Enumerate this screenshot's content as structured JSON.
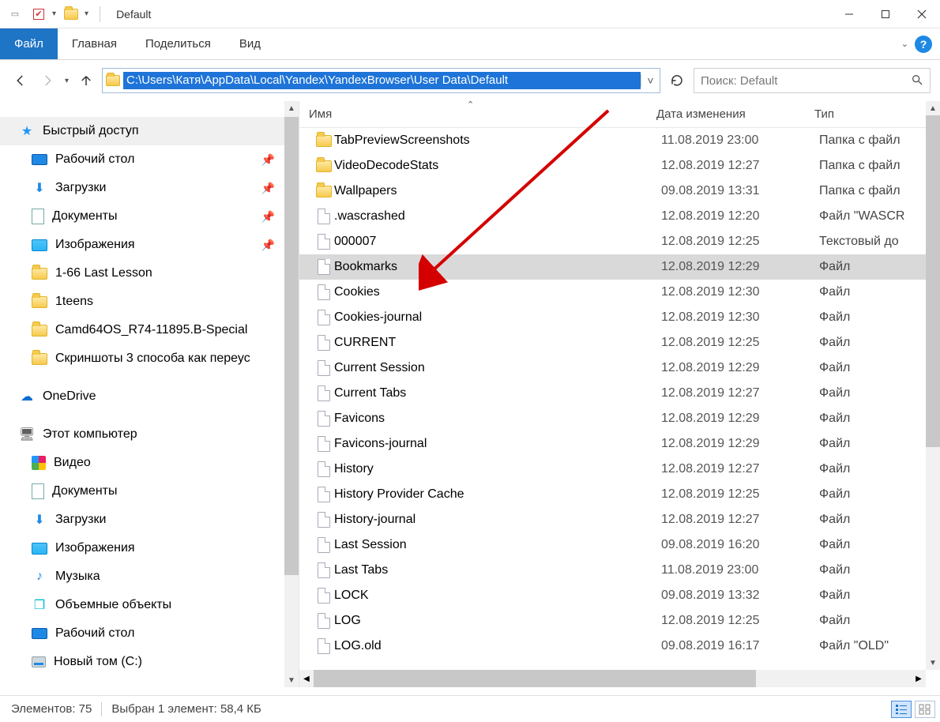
{
  "window": {
    "title": "Default"
  },
  "ribbon": {
    "file": "Файл",
    "tabs": [
      "Главная",
      "Поделиться",
      "Вид"
    ]
  },
  "address": {
    "path": "C:\\Users\\Катя\\AppData\\Local\\Yandex\\YandexBrowser\\User Data\\Default"
  },
  "search": {
    "placeholder": "Поиск: Default"
  },
  "sidebar": {
    "quick_access": "Быстрый доступ",
    "quick_items": [
      {
        "label": "Рабочий стол",
        "icon": "desktop",
        "pinned": true
      },
      {
        "label": "Загрузки",
        "icon": "download",
        "pinned": true
      },
      {
        "label": "Документы",
        "icon": "doc",
        "pinned": true
      },
      {
        "label": "Изображения",
        "icon": "image",
        "pinned": true
      },
      {
        "label": "1-66 Last Lesson",
        "icon": "folder",
        "pinned": false
      },
      {
        "label": "1teens",
        "icon": "folder",
        "pinned": false
      },
      {
        "label": "Camd64OS_R74-11895.B-Special",
        "icon": "folder",
        "pinned": false
      },
      {
        "label": "Скриншоты 3 способа как переус",
        "icon": "folder",
        "pinned": false
      }
    ],
    "onedrive": "OneDrive",
    "this_pc": "Этот компьютер",
    "pc_items": [
      {
        "label": "Видео",
        "icon": "video"
      },
      {
        "label": "Документы",
        "icon": "doc"
      },
      {
        "label": "Загрузки",
        "icon": "download"
      },
      {
        "label": "Изображения",
        "icon": "image"
      },
      {
        "label": "Музыка",
        "icon": "music"
      },
      {
        "label": "Объемные объекты",
        "icon": "obj3d"
      },
      {
        "label": "Рабочий стол",
        "icon": "desktop"
      },
      {
        "label": "Новый том (C:)",
        "icon": "disk"
      }
    ]
  },
  "columns": {
    "name": "Имя",
    "date": "Дата изменения",
    "type": "Тип"
  },
  "files": [
    {
      "name": "TabPreviewScreenshots",
      "date": "11.08.2019 23:00",
      "type": "Папка с файл",
      "icon": "folder"
    },
    {
      "name": "VideoDecodeStats",
      "date": "12.08.2019 12:27",
      "type": "Папка с файл",
      "icon": "folder"
    },
    {
      "name": "Wallpapers",
      "date": "09.08.2019 13:31",
      "type": "Папка с файл",
      "icon": "folder"
    },
    {
      "name": ".wascrashed",
      "date": "12.08.2019 12:20",
      "type": "Файл \"WASCR",
      "icon": "file"
    },
    {
      "name": "000007",
      "date": "12.08.2019 12:25",
      "type": "Текстовый до",
      "icon": "file"
    },
    {
      "name": "Bookmarks",
      "date": "12.08.2019 12:29",
      "type": "Файл",
      "icon": "file",
      "selected": true
    },
    {
      "name": "Cookies",
      "date": "12.08.2019 12:30",
      "type": "Файл",
      "icon": "file"
    },
    {
      "name": "Cookies-journal",
      "date": "12.08.2019 12:30",
      "type": "Файл",
      "icon": "file"
    },
    {
      "name": "CURRENT",
      "date": "12.08.2019 12:25",
      "type": "Файл",
      "icon": "file"
    },
    {
      "name": "Current Session",
      "date": "12.08.2019 12:29",
      "type": "Файл",
      "icon": "file"
    },
    {
      "name": "Current Tabs",
      "date": "12.08.2019 12:27",
      "type": "Файл",
      "icon": "file"
    },
    {
      "name": "Favicons",
      "date": "12.08.2019 12:29",
      "type": "Файл",
      "icon": "file"
    },
    {
      "name": "Favicons-journal",
      "date": "12.08.2019 12:29",
      "type": "Файл",
      "icon": "file"
    },
    {
      "name": "History",
      "date": "12.08.2019 12:27",
      "type": "Файл",
      "icon": "file"
    },
    {
      "name": "History Provider Cache",
      "date": "12.08.2019 12:25",
      "type": "Файл",
      "icon": "file"
    },
    {
      "name": "History-journal",
      "date": "12.08.2019 12:27",
      "type": "Файл",
      "icon": "file"
    },
    {
      "name": "Last Session",
      "date": "09.08.2019 16:20",
      "type": "Файл",
      "icon": "file"
    },
    {
      "name": "Last Tabs",
      "date": "11.08.2019 23:00",
      "type": "Файл",
      "icon": "file"
    },
    {
      "name": "LOCK",
      "date": "09.08.2019 13:32",
      "type": "Файл",
      "icon": "file"
    },
    {
      "name": "LOG",
      "date": "12.08.2019 12:25",
      "type": "Файл",
      "icon": "file"
    },
    {
      "name": "LOG.old",
      "date": "09.08.2019 16:17",
      "type": "Файл \"OLD\"",
      "icon": "file"
    }
  ],
  "status": {
    "count_label": "Элементов: 75",
    "selection_label": "Выбран 1 элемент: 58,4 КБ"
  }
}
